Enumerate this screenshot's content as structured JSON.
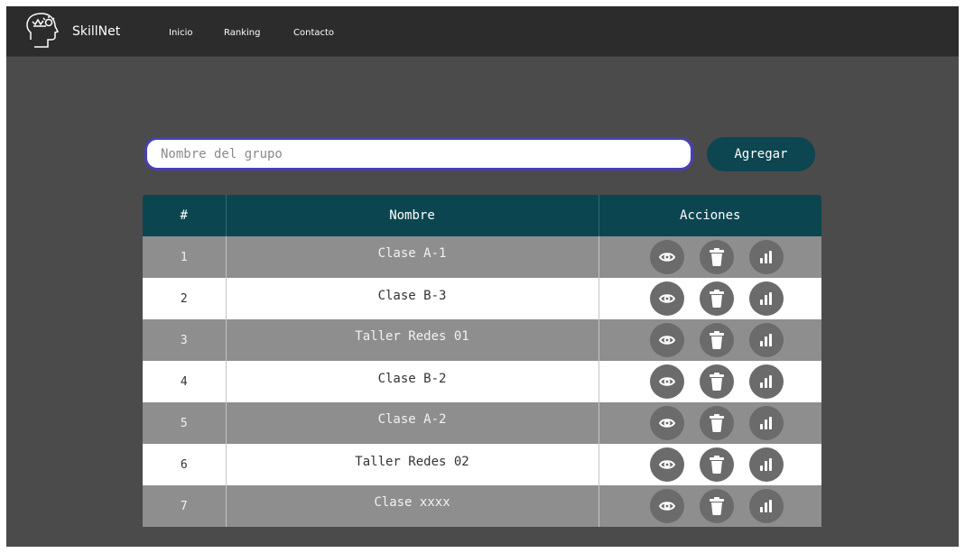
{
  "navbar": {
    "brand": "SkillNet",
    "links": [
      "Inicio",
      "Ranking",
      "Contacto"
    ]
  },
  "form": {
    "placeholder": "Nombre del grupo",
    "add_label": "Agregar"
  },
  "table": {
    "headers": [
      "#",
      "Nombre",
      "Acciones"
    ],
    "rows": [
      {
        "num": "1",
        "name": "Clase A-1"
      },
      {
        "num": "2",
        "name": "Clase B-3"
      },
      {
        "num": "3",
        "name": "Taller Redes 01"
      },
      {
        "num": "4",
        "name": "Clase B-2"
      },
      {
        "num": "5",
        "name": "Clase A-2"
      },
      {
        "num": "6",
        "name": "Taller Redes 02"
      },
      {
        "num": "7",
        "name": "Clase xxxx"
      }
    ],
    "actions": [
      "view-icon",
      "trash-icon",
      "chart-icon"
    ]
  },
  "colors": {
    "navbar": "#2c2c2c",
    "background": "#4b4b4b",
    "accent": "#0d4550",
    "input_border": "#4a3fb8",
    "row_odd": "#8e8e8e",
    "row_even": "#ffffff"
  }
}
